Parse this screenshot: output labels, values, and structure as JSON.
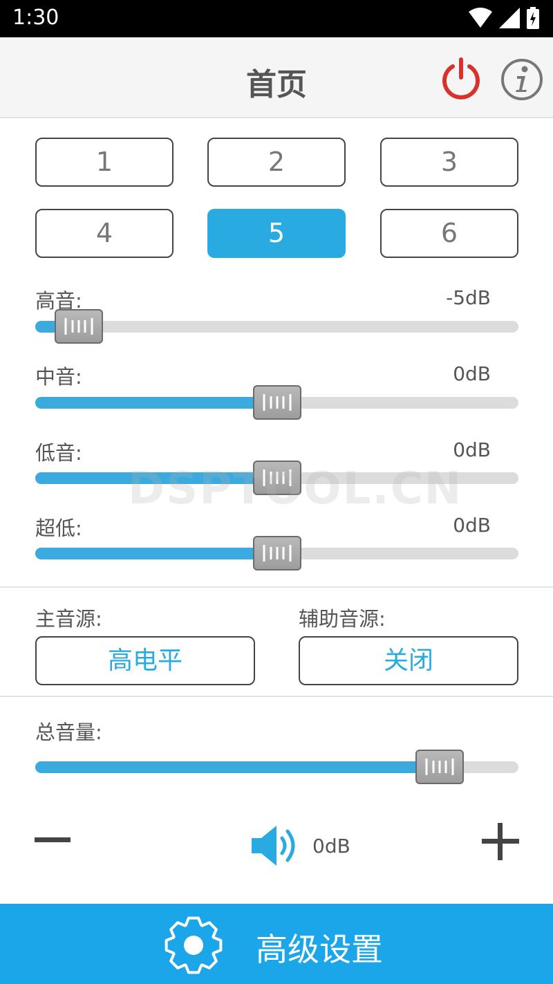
{
  "status_bar": {
    "time": "1:30"
  },
  "header": {
    "title": "首页"
  },
  "presets": [
    {
      "label": "1",
      "active": false
    },
    {
      "label": "2",
      "active": false
    },
    {
      "label": "3",
      "active": false
    },
    {
      "label": "4",
      "active": false
    },
    {
      "label": "5",
      "active": true
    },
    {
      "label": "6",
      "active": false
    }
  ],
  "eq": [
    {
      "label": "高音:",
      "value": "-5dB",
      "level": 0.09
    },
    {
      "label": "中音:",
      "value": "0dB",
      "level": 0.5
    },
    {
      "label": "低音:",
      "value": "0dB",
      "level": 0.5
    },
    {
      "label": "超低:",
      "value": "0dB",
      "level": 0.5
    }
  ],
  "source": {
    "main_label": "主音源:",
    "main_value": "高电平",
    "aux_label": "辅助音源:",
    "aux_value": "关闭"
  },
  "volume": {
    "label": "总音量:",
    "value": "0dB",
    "level": 0.837
  },
  "watermark": "DSPTOOL.CN",
  "bottom_bar": {
    "label": "高级设置"
  },
  "colors": {
    "accent": "#29abe2",
    "power": "#d9312c",
    "bar": "#1aa6e8",
    "track": "#dcdcdc"
  }
}
